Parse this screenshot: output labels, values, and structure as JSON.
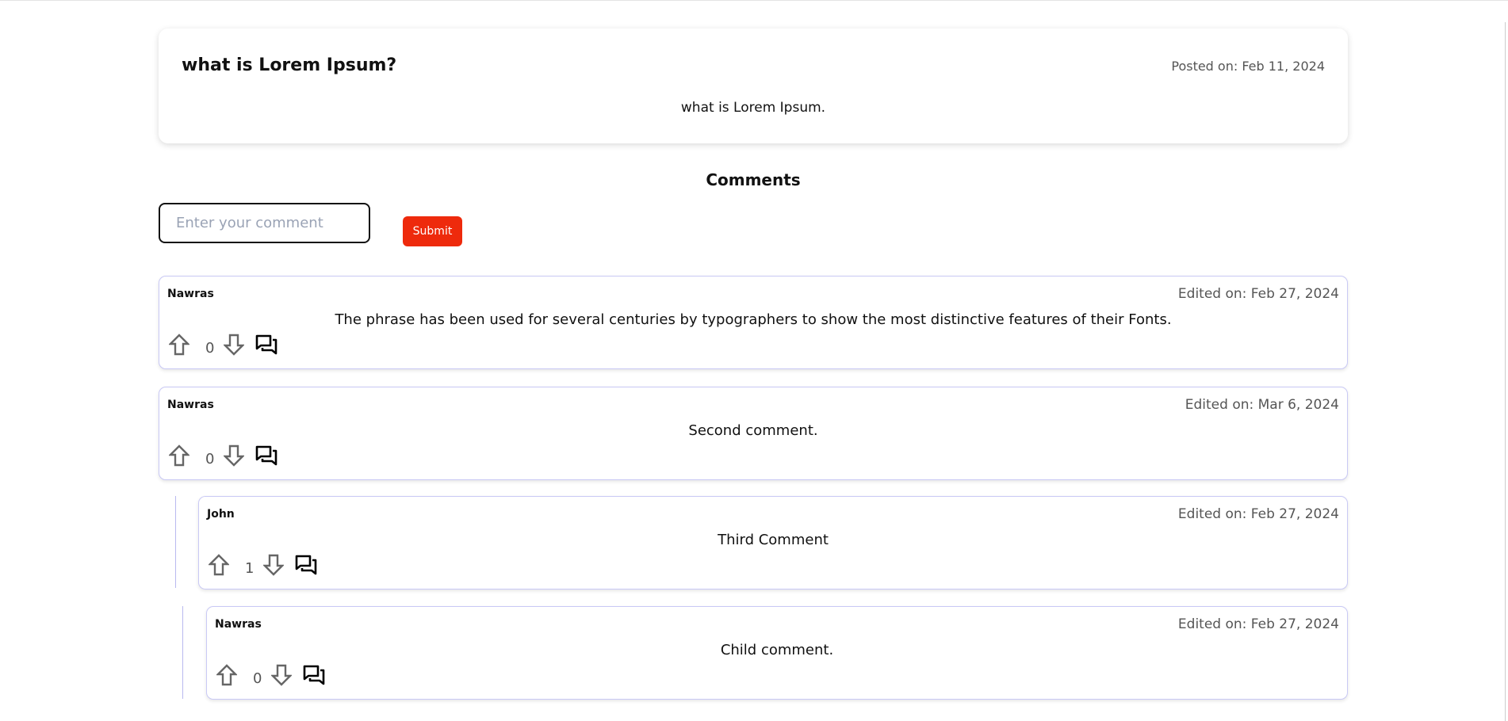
{
  "post": {
    "title": "what is Lorem Ipsum?",
    "date": "Posted on: Feb 11, 2024",
    "body": "what is Lorem Ipsum."
  },
  "comments_section": {
    "heading": "Comments",
    "input_placeholder": "Enter your comment",
    "input_value": "",
    "submit_label": "Submit",
    "submit_color": "#ee2a0c"
  },
  "comments": [
    {
      "author": "Nawras",
      "date": "Edited on: Feb 27, 2024",
      "text": "The phrase has been used for several centuries by typographers to show the most distinctive features of their Fonts.",
      "votes": "0"
    },
    {
      "author": "Nawras",
      "date": "Edited on: Mar 6, 2024",
      "text": "Second comment.",
      "votes": "0"
    },
    {
      "author": "John",
      "date": "Edited on: Feb 27, 2024",
      "text": "Third Comment",
      "votes": "1"
    },
    {
      "author": "Nawras",
      "date": "Edited on: Feb 27, 2024",
      "text": "Child comment.",
      "votes": "0"
    }
  ]
}
